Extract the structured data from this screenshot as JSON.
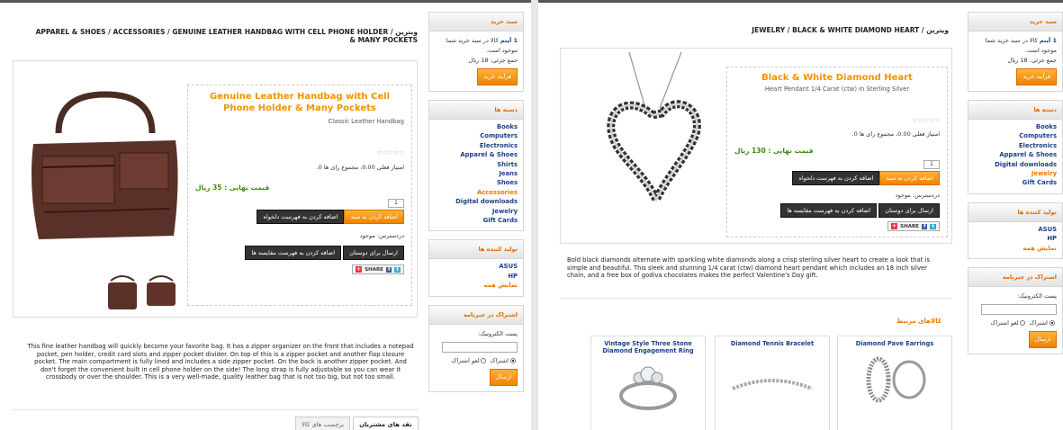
{
  "left": {
    "breadcrumb": "APPAREL & SHOES / ACCESSORIES / GENUINE LEATHER HANDBAG WITH CELL PHONE HOLDER & MANY POCKETS",
    "breadcrumb_home": "ویترین /",
    "product": {
      "title": "Genuine Leather Handbag with Cell Phone Holder & Many Pockets",
      "short": "Classic Leather Handbag",
      "stars": "☆☆☆☆☆",
      "rating": "امتیاز فعلی 0.00، مجموع رای ها 0.",
      "price": "قیمت نهایی : 35 ریال",
      "qty": "1",
      "add_to_cart": "اضافه کردن به سبد",
      "add_wishlist": "اضافه کردن به فهرست دلخواه",
      "availability": "دردسترس: موجود",
      "email_friend": "ارسال برای دوستان",
      "compare": "اضافه کردن به فهرست مقایسه ها",
      "share": "SHARE",
      "description": "This fine leather handbag will quickly become your favorite bag. It has a zipper organizer on the front that includes a notepad pocket, pen holder, credit card slots and zipper pocket divider. On top of this is a zipper pocket and another flap closure pocket. The main compartment is fully lined and includes a side zipper pocket. On the back is another zipper pocket. And don't forget the convenient built in cell phone holder on the side! The long strap is fully adjustable so you can wear it crossbody or over the shoulder. This is a very well-made, quality leather bag that is not too big, but not too small."
    },
    "tabs": [
      "نقد های مشتریان",
      "برچسب های کالا"
    ],
    "sidebar": {
      "cart_title": "سبد خرید",
      "cart_line1_bold": "1 آیتم",
      "cart_line1": "کالا در سبد خرید شما موجود است.",
      "cart_total": "جمع جزئی: 18 ریال",
      "cart_button": "فرآیند خرید",
      "categories_title": "دسته ها",
      "categories": [
        "Books",
        "Computers",
        "Electronics",
        "Apparel & Shoes",
        "Shirts",
        "Jeans",
        "Shoes",
        "Accessories",
        "Digital downloads",
        "Jewelry",
        "Gift Cards"
      ],
      "manufacturers_title": "تولید کننده ها",
      "manufacturers": [
        "ASUS",
        "HP"
      ],
      "manufacturers_all": "نمایش همه",
      "newsletter_title": "اشتراک در خبرنامه",
      "newsletter_label": "پست الکترونیک:",
      "subscribe": "اشتراک",
      "unsubscribe": "لغو اشتراک",
      "newsletter_button": "ارسال"
    }
  },
  "right": {
    "breadcrumb": "JEWELRY / BLACK & WHITE DIAMOND HEART",
    "breadcrumb_home": "ویترین /",
    "product": {
      "title": "Black & White Diamond Heart",
      "short": "Heart Pendant 1/4 Carat (ctw) in Sterling Silver",
      "stars": "☆☆☆☆☆",
      "rating": "امتیاز فعلی 0.00، مجموع رای ها 0.",
      "price": "قیمت نهایی : 130 ریال",
      "qty": "1",
      "add_to_cart": "اضافه کردن به سبد",
      "add_wishlist": "اضافه کردن به فهرست دلخواه",
      "availability": "دردسترس: موجود",
      "email_friend": "ارسال برای دوستان",
      "compare": "اضافه کردن به فهرست مقایسه ها",
      "share": "SHARE",
      "description": "Bold black diamonds alternate with sparkling white diamonds along a crisp sterling silver heart to create a look that is simple and beautiful. This sleek and stunning 1/4 carat (ctw) diamond heart pendant which includes an 18 inch silver chain, and a free box of godiva chocolates makes the perfect Valentine's Day gift."
    },
    "related_title": "کالاهای مرتبط",
    "related": [
      {
        "title": "Diamond Pave Earrings"
      },
      {
        "title": "Diamond Tennis Bracelet"
      },
      {
        "title": "Vintage Style Three Stone Diamond Engagement Ring"
      }
    ],
    "sidebar": {
      "cart_title": "سبد خرید",
      "cart_line1_bold": "1 آیتم",
      "cart_line1": "کالا در سبد خرید شما موجود است.",
      "cart_total": "جمع جزئی: 18 ریال",
      "cart_button": "فرآیند خرید",
      "categories_title": "دسته ها",
      "categories": [
        "Books",
        "Computers",
        "Electronics",
        "Apparel & Shoes",
        "Digital downloads",
        "Jewelry",
        "Gift Cards"
      ],
      "manufacturers_title": "تولید کننده ها",
      "manufacturers": [
        "ASUS",
        "HP"
      ],
      "manufacturers_all": "نمایش همه",
      "newsletter_title": "اشتراک در خبرنامه",
      "newsletter_label": "پست الکترونیک:",
      "subscribe": "اشتراک",
      "unsubscribe": "لغو اشتراک",
      "newsletter_button": "ارسال"
    }
  }
}
